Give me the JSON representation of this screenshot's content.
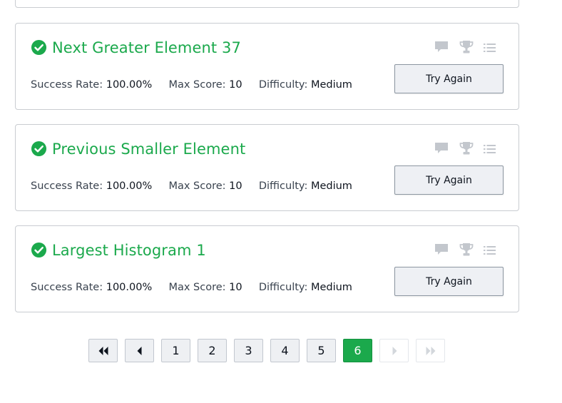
{
  "problems": [
    {
      "title": "Next Greater Element 37",
      "success_label": "Success Rate:",
      "success_value": "100.00%",
      "score_label": "Max Score:",
      "score_value": "10",
      "difficulty_label": "Difficulty:",
      "difficulty_value": "Medium",
      "button_label": "Try Again"
    },
    {
      "title": "Previous Smaller Element",
      "success_label": "Success Rate:",
      "success_value": "100.00%",
      "score_label": "Max Score:",
      "score_value": "10",
      "difficulty_label": "Difficulty:",
      "difficulty_value": "Medium",
      "button_label": "Try Again"
    },
    {
      "title": "Largest Histogram 1",
      "success_label": "Success Rate:",
      "success_value": "100.00%",
      "score_label": "Max Score:",
      "score_value": "10",
      "difficulty_label": "Difficulty:",
      "difficulty_value": "Medium",
      "button_label": "Try Again"
    }
  ],
  "pagination": {
    "pages": [
      "1",
      "2",
      "3",
      "4",
      "5",
      "6"
    ],
    "current": "6"
  },
  "icons": {
    "solved": "check-circle-icon",
    "discussion": "comment-icon",
    "leaderboard": "trophy-icon",
    "editorial": "list-icon",
    "first": "double-chevron-left-icon",
    "prev": "chevron-left-icon",
    "next": "chevron-right-icon",
    "last": "double-chevron-right-icon"
  },
  "colors": {
    "success_green": "#1ba94c",
    "muted_icon": "#c3c7cd",
    "border": "#c9ccd1"
  }
}
